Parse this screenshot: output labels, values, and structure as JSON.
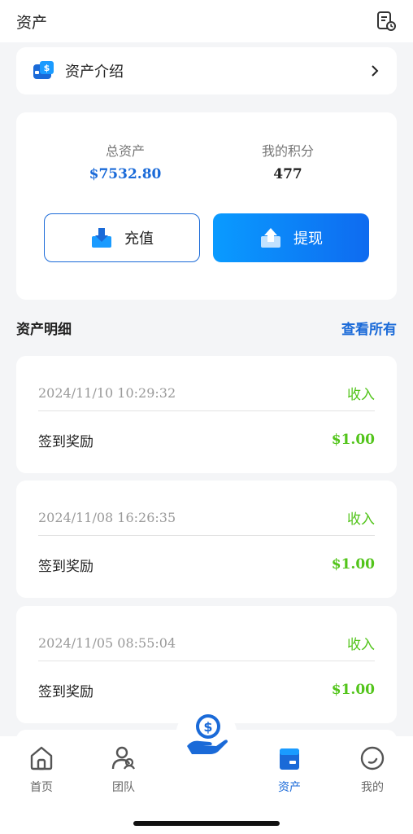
{
  "header": {
    "title": "资产",
    "icon": "document-clock-icon"
  },
  "intro": {
    "label": "资产介绍",
    "icon": "wallet-dollar-icon"
  },
  "assets": {
    "total_label": "总资产",
    "total_value": "$7532.80",
    "points_label": "我的积分",
    "points_value": "477",
    "recharge_label": "充值",
    "withdraw_label": "提现"
  },
  "details": {
    "title": "资产明细",
    "view_all": "查看所有",
    "records": [
      {
        "date": "2024/11/10 10:29:32",
        "type": "收入",
        "desc": "签到奖励",
        "amount": "$1.00"
      },
      {
        "date": "2024/11/08 16:26:35",
        "type": "收入",
        "desc": "签到奖励",
        "amount": "$1.00"
      },
      {
        "date": "2024/11/05 08:55:04",
        "type": "收入",
        "desc": "签到奖励",
        "amount": "$1.00"
      }
    ]
  },
  "tabbar": {
    "home": "首页",
    "team": "团队",
    "assets": "资产",
    "mine": "我的"
  },
  "colors": {
    "accent": "#1a6ad8",
    "income": "#52c41a",
    "background": "#f4f5f7"
  }
}
